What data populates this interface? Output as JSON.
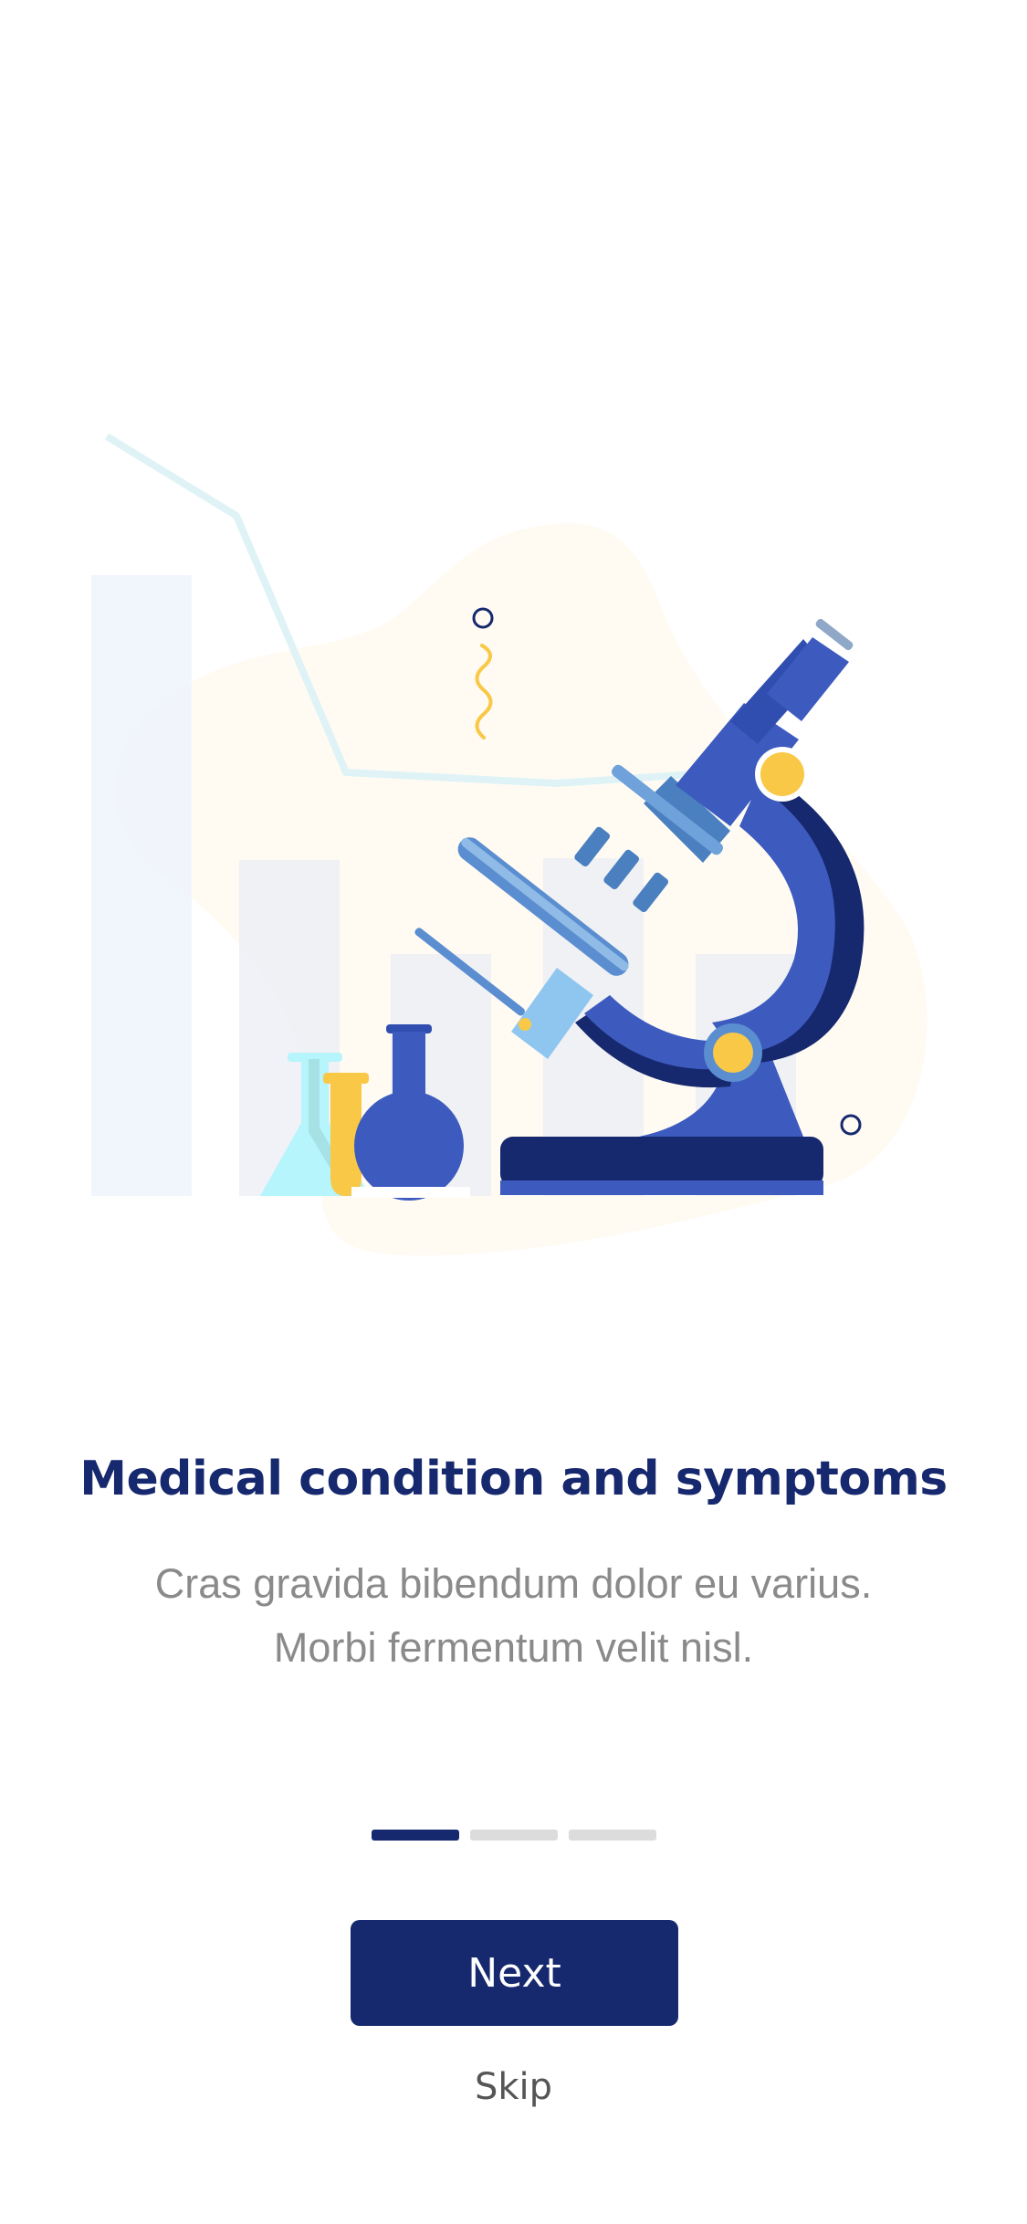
{
  "onboarding": {
    "title": "Medical condition and symptoms",
    "description_lines": [
      "Cras gravida bibendum dolor eu varius.",
      "Morbi fermentum velit nisl."
    ],
    "pagination": {
      "current": 1,
      "total": 3
    },
    "next_label": "Next",
    "skip_label": "Skip"
  },
  "illustration": {
    "icon": "microscope-lab-illustration"
  },
  "colors": {
    "primary": "#16286e",
    "accent_blue": "#3d5bbf",
    "accent_yellow": "#f9c846",
    "text_muted": "#8a8a8a",
    "dot_inactive": "#dcdcdc"
  }
}
